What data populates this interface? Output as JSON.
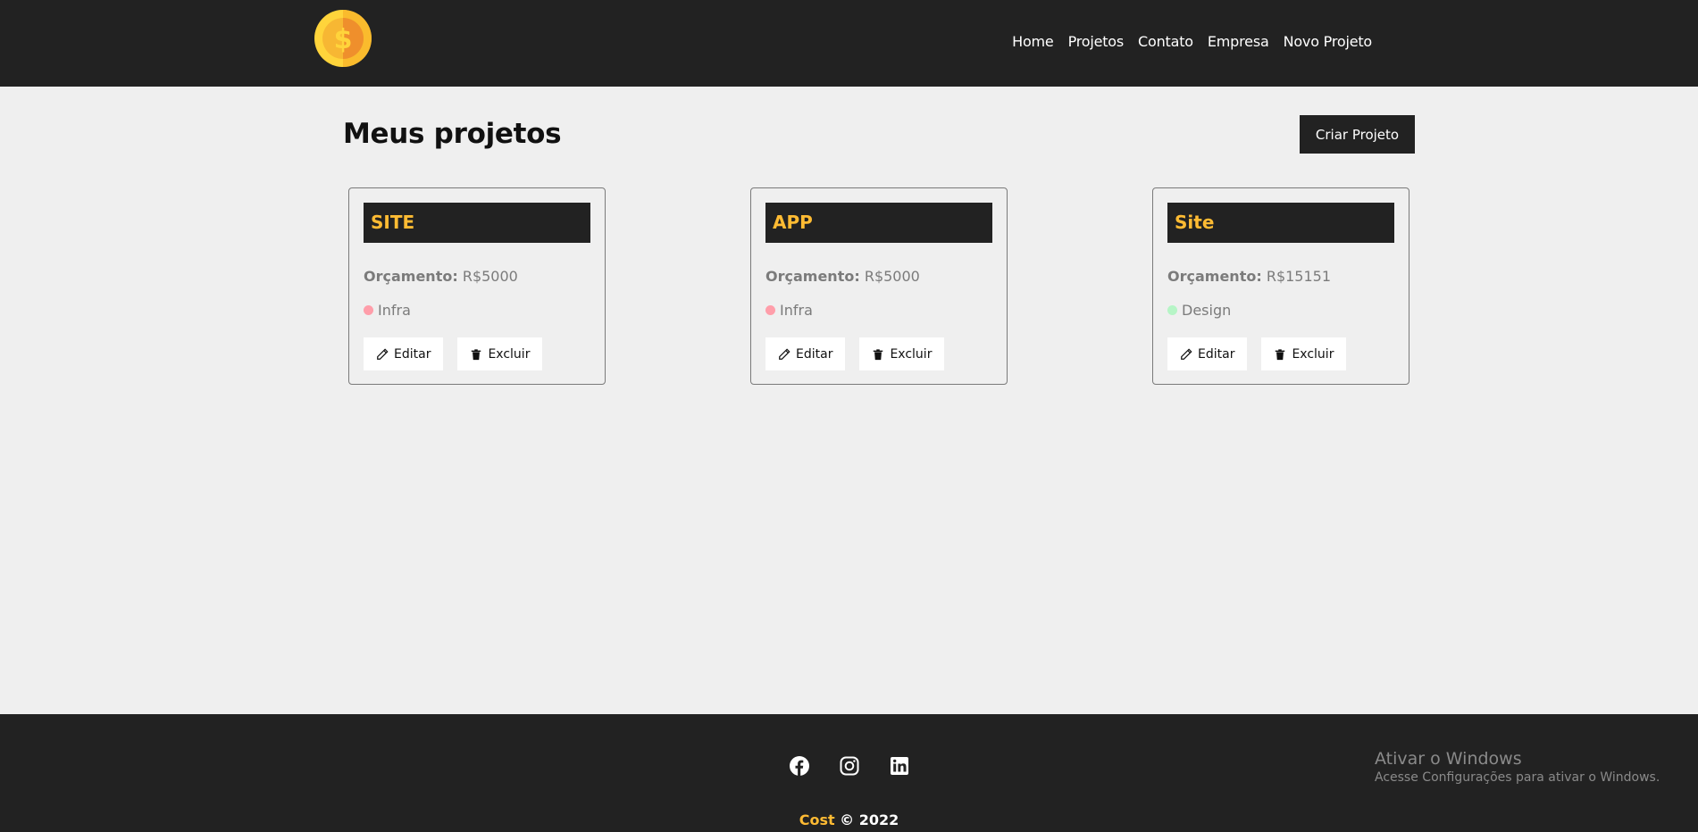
{
  "nav": {
    "logo_icon": "dollar-coin-icon",
    "links": [
      "Home",
      "Projetos",
      "Contato",
      "Empresa",
      "Novo Projeto"
    ]
  },
  "main": {
    "title": "Meus projetos",
    "create_button": "Criar Projeto"
  },
  "projects": [
    {
      "name": "SITE",
      "budget_label": "Orçamento:",
      "budget_value": "R$5000",
      "category": "Infra",
      "category_color": "#ff9eaa",
      "edit_label": "Editar",
      "delete_label": "Excluir"
    },
    {
      "name": "APP",
      "budget_label": "Orçamento:",
      "budget_value": "R$5000",
      "category": "Infra",
      "category_color": "#ff9eaa",
      "edit_label": "Editar",
      "delete_label": "Excluir"
    },
    {
      "name": "Site",
      "budget_label": "Orçamento:",
      "budget_value": "R$15151",
      "category": "Design",
      "category_color": "#b6f5c6",
      "edit_label": "Editar",
      "delete_label": "Excluir"
    }
  ],
  "footer": {
    "social_icons": [
      "facebook-icon",
      "instagram-icon",
      "linkedin-icon"
    ],
    "brand": "Cost",
    "copyright": " © 2022"
  },
  "windows_watermark": {
    "title": "Ativar o Windows",
    "subtitle": "Acesse Configurações para ativar o Windows."
  },
  "colors": {
    "dark": "#222222",
    "accent": "#ffbb33",
    "background": "#efefef"
  }
}
